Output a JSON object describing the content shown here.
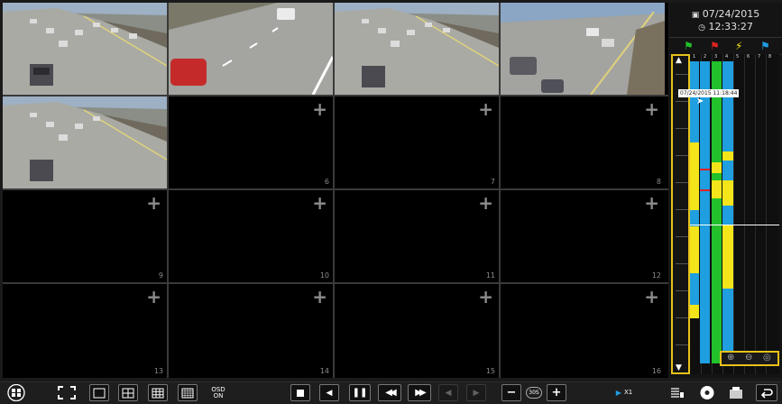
{
  "panel": {
    "date": "07/24/2015",
    "time": "12:33:27",
    "timestamp_tooltip": "07/24/2015 11:18:44",
    "channel_numbers": [
      "1",
      "2",
      "3",
      "4",
      "5",
      "6",
      "7",
      "8"
    ]
  },
  "grid": {
    "cell_numbers": [
      "6",
      "7",
      "8",
      "9",
      "10",
      "11",
      "12",
      "13",
      "14",
      "15",
      "16"
    ]
  },
  "toolbar": {
    "osd_line1": "OSD",
    "osd_line2": "ON",
    "step_label": "30S",
    "speed_label": "X1"
  },
  "colors": {
    "accent": "#e8c21a",
    "track_blue": "#1f9ee0",
    "track_green": "#22c02a",
    "track_yellow": "#f3e51a"
  },
  "icons": {
    "layout": "layout-menu-icon",
    "fullscreen": "fullscreen-icon",
    "stop": "stop-icon",
    "pause": "pause-icon"
  }
}
